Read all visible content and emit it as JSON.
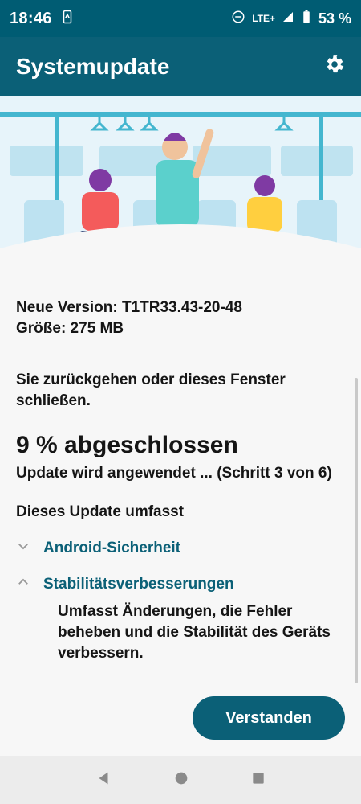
{
  "status_bar": {
    "time": "18:46",
    "network": "LTE+",
    "battery": "53 %"
  },
  "app_bar": {
    "title": "Systemupdate",
    "settings_icon": "gear-icon"
  },
  "hero_illustration": {
    "description_icon": "subway-people-illustration"
  },
  "update_info": {
    "version_line": "Neue Version: T1TR33.43-20-48",
    "size_line": "Größe: 275 MB",
    "warning_line": "Sie zurückgehen oder dieses Fenster schließen.",
    "progress_main": "9 % abgeschlossen",
    "progress_sub": "Update wird angewendet ... (Schritt 3 von 6)",
    "includes_label": "Dieses Update umfasst"
  },
  "includes": [
    {
      "label": "Android-Sicherheit",
      "expanded": false
    },
    {
      "label": "Stabilitätsverbesserungen",
      "expanded": true,
      "detail": "Umfasst Änderungen, die Fehler beheben und die Stabilität des Geräts verbessern."
    }
  ],
  "actions": {
    "understood": "Verstanden"
  }
}
